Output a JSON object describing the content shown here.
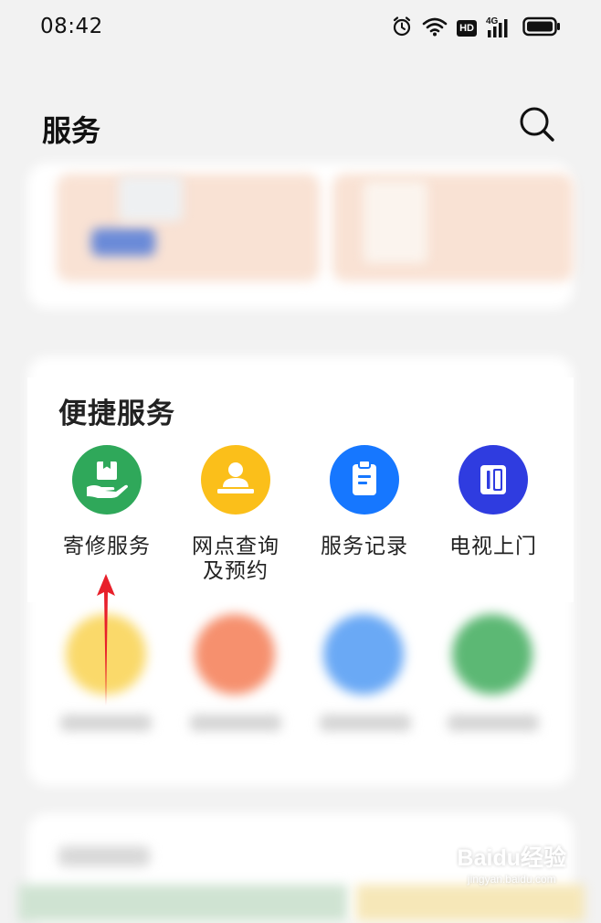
{
  "status_bar": {
    "time": "08:42",
    "hd_label": "HD",
    "network_label": "4G"
  },
  "header": {
    "title": "服务"
  },
  "quick_services": {
    "title": "便捷服务",
    "items": [
      {
        "label": "寄修服务",
        "icon": "box-hand-icon",
        "color": "#2fa85a"
      },
      {
        "label_line1": "网点查询",
        "label_line2": "及预约",
        "icon": "person-desk-icon",
        "color": "#fbbf1a"
      },
      {
        "label": "服务记录",
        "icon": "clipboard-icon",
        "color": "#1677ff"
      },
      {
        "label": "电视上门",
        "icon": "tv-box-icon",
        "color": "#2f3ce0"
      }
    ]
  },
  "watermark": {
    "text": "Baidu经验",
    "sub": "jingyan.baidu.com"
  },
  "colors": {
    "background": "#f2f2f2",
    "card": "#ffffff",
    "arrow": "#e8202a"
  }
}
